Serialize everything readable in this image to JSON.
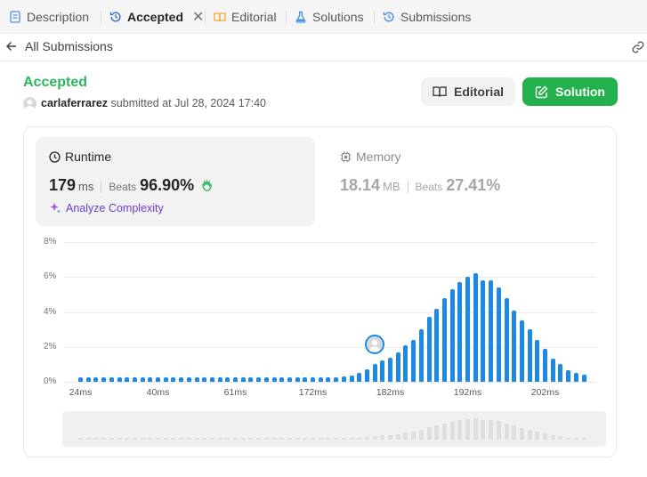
{
  "tabs": [
    {
      "label": "Description",
      "icon": "description-icon"
    },
    {
      "label": "Accepted",
      "icon": "history-icon",
      "active": true
    },
    {
      "label": "Editorial",
      "icon": "book-icon"
    },
    {
      "label": "Solutions",
      "icon": "flask-icon"
    },
    {
      "label": "Submissions",
      "icon": "history-icon"
    }
  ],
  "nav": {
    "back_label": "All Submissions"
  },
  "submission": {
    "status": "Accepted",
    "status_color": "#2db55d",
    "user": "carlaferrarez",
    "submitted_text": "submitted at Jul 28, 2024 17:40"
  },
  "actions": {
    "editorial_label": "Editorial",
    "solution_label": "Solution"
  },
  "runtime": {
    "title": "Runtime",
    "value": "179",
    "unit": "ms",
    "beats_label": "Beats",
    "beats_pct": "96.90%",
    "analyze_label": "Analyze Complexity"
  },
  "memory": {
    "title": "Memory",
    "value": "18.14",
    "unit": "MB",
    "beats_label": "Beats",
    "beats_pct": "27.41%"
  },
  "chart_data": {
    "type": "bar",
    "yticks": [
      "8%",
      "6%",
      "4%",
      "2%",
      "0%"
    ],
    "ylim": [
      0,
      8
    ],
    "xticks": [
      "24ms",
      "40ms",
      "61ms",
      "172ms",
      "182ms",
      "192ms",
      "202ms"
    ],
    "xtick_bar_index": [
      0,
      10,
      20,
      30,
      40,
      50,
      60
    ],
    "values": [
      0.25,
      0.25,
      0.25,
      0.25,
      0.25,
      0.25,
      0.25,
      0.25,
      0.25,
      0.25,
      0.25,
      0.25,
      0.25,
      0.25,
      0.25,
      0.25,
      0.25,
      0.25,
      0.25,
      0.25,
      0.25,
      0.25,
      0.25,
      0.25,
      0.25,
      0.25,
      0.25,
      0.25,
      0.25,
      0.25,
      0.25,
      0.25,
      0.25,
      0.25,
      0.3,
      0.35,
      0.5,
      0.7,
      1.0,
      1.2,
      1.4,
      1.7,
      2.1,
      2.4,
      3.0,
      3.7,
      4.2,
      4.8,
      5.3,
      5.7,
      6.0,
      6.2,
      5.8,
      5.8,
      5.4,
      4.8,
      4.1,
      3.5,
      3.0,
      2.4,
      1.9,
      1.3,
      1.0,
      0.65,
      0.5,
      0.4
    ],
    "highlight_index": 38,
    "bar_color": "#1e88e5",
    "grid": true
  }
}
